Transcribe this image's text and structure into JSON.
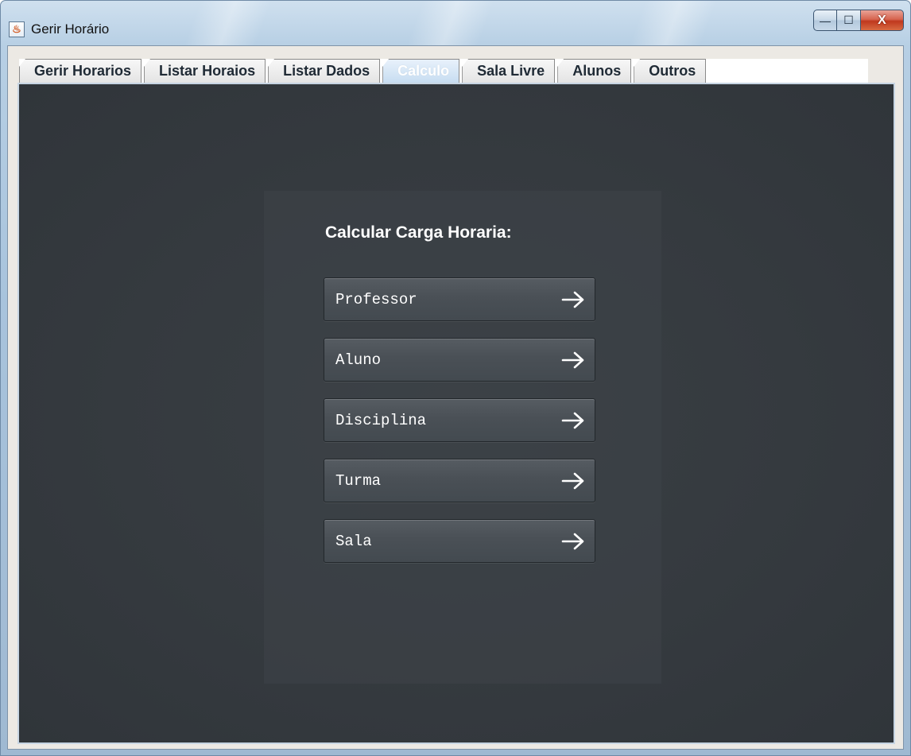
{
  "window": {
    "title": "Gerir Horário",
    "icon": "java-cup-icon",
    "controls": {
      "minimize": "—",
      "maximize": "☐",
      "close": "X"
    }
  },
  "tabs": [
    {
      "label": "Gerir Horarios",
      "selected": false
    },
    {
      "label": "Listar Horaios",
      "selected": false
    },
    {
      "label": "Listar Dados",
      "selected": false
    },
    {
      "label": "Calculo",
      "selected": true
    },
    {
      "label": "Sala Livre",
      "selected": false
    },
    {
      "label": "Alunos",
      "selected": false
    },
    {
      "label": "Outros",
      "selected": false
    }
  ],
  "panel": {
    "heading": "Calcular Carga Horaria:",
    "buttons": [
      {
        "label": "Professor",
        "icon": "arrow-right-icon"
      },
      {
        "label": "Aluno",
        "icon": "arrow-right-icon"
      },
      {
        "label": "Disciplina",
        "icon": "arrow-right-icon"
      },
      {
        "label": "Turma",
        "icon": "arrow-right-icon"
      },
      {
        "label": "Sala",
        "icon": "arrow-right-icon"
      }
    ]
  },
  "colors": {
    "panel_bg": "#353a3f",
    "button_bg": "#4a5056",
    "text": "#ffffff",
    "selected_tab": "#c7ddf1"
  }
}
